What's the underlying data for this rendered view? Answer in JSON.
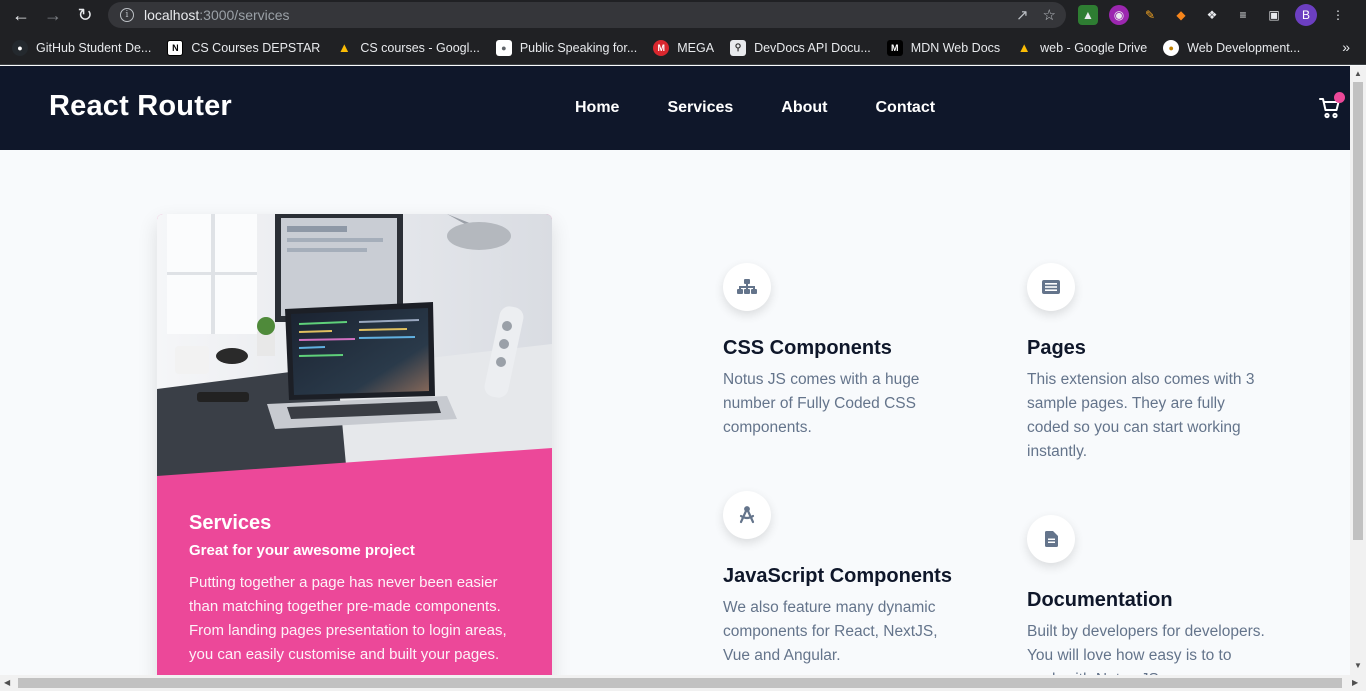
{
  "browser": {
    "url_host": "localhost",
    "url_path": ":3000/services",
    "profile_initial": "B",
    "bookmarks": [
      {
        "label": "GitHub Student De...",
        "icon": "github-icon",
        "color": "#24292e"
      },
      {
        "label": "CS Courses DEPSTAR",
        "icon": "notion-icon",
        "color": "#000000"
      },
      {
        "label": "CS courses - Googl...",
        "icon": "google-drive-icon",
        "color": "#1a73e8"
      },
      {
        "label": "Public Speaking for...",
        "icon": "map-pin-icon",
        "color": "#5f6368"
      },
      {
        "label": "MEGA",
        "icon": "mega-icon",
        "color": "#d9272e"
      },
      {
        "label": "DevDocs API Docu...",
        "icon": "devdocs-icon",
        "color": "#5f6368"
      },
      {
        "label": "MDN Web Docs",
        "icon": "mdn-icon",
        "color": "#000000"
      },
      {
        "label": "web - Google Drive",
        "icon": "google-drive-icon",
        "color": "#1a73e8"
      },
      {
        "label": "Web Development...",
        "icon": "dev-icon",
        "color": "#f0c000"
      }
    ],
    "more_label": "»"
  },
  "nav": {
    "brand": "React Router",
    "links": [
      "Home",
      "Services",
      "About",
      "Contact"
    ]
  },
  "card": {
    "title": "Services",
    "subtitle": "Great for your awesome project",
    "text": "Putting together a page has never been easier than matching together pre-made components. From landing pages presentation to login areas, you can easily customise and built your pages."
  },
  "features": [
    {
      "icon": "sitemap-icon",
      "title": "CSS Components",
      "desc": "Notus JS comes with a huge number of Fully Coded CSS components."
    },
    {
      "icon": "drafting-compass-icon",
      "title": "JavaScript Components",
      "desc": "We also feature many dynamic components for React, NextJS, Vue and Angular."
    },
    {
      "icon": "newspaper-icon",
      "title": "Pages",
      "desc": "This extension also comes with 3 sample pages. They are fully coded so you can start working instantly."
    },
    {
      "icon": "file-icon",
      "title": "Documentation",
      "desc": "Built by developers for developers. You will love how easy is to to work with Notus JS."
    }
  ],
  "colors": {
    "header": "#0f172a",
    "accent": "#ec4899",
    "icon": "#64748b"
  }
}
